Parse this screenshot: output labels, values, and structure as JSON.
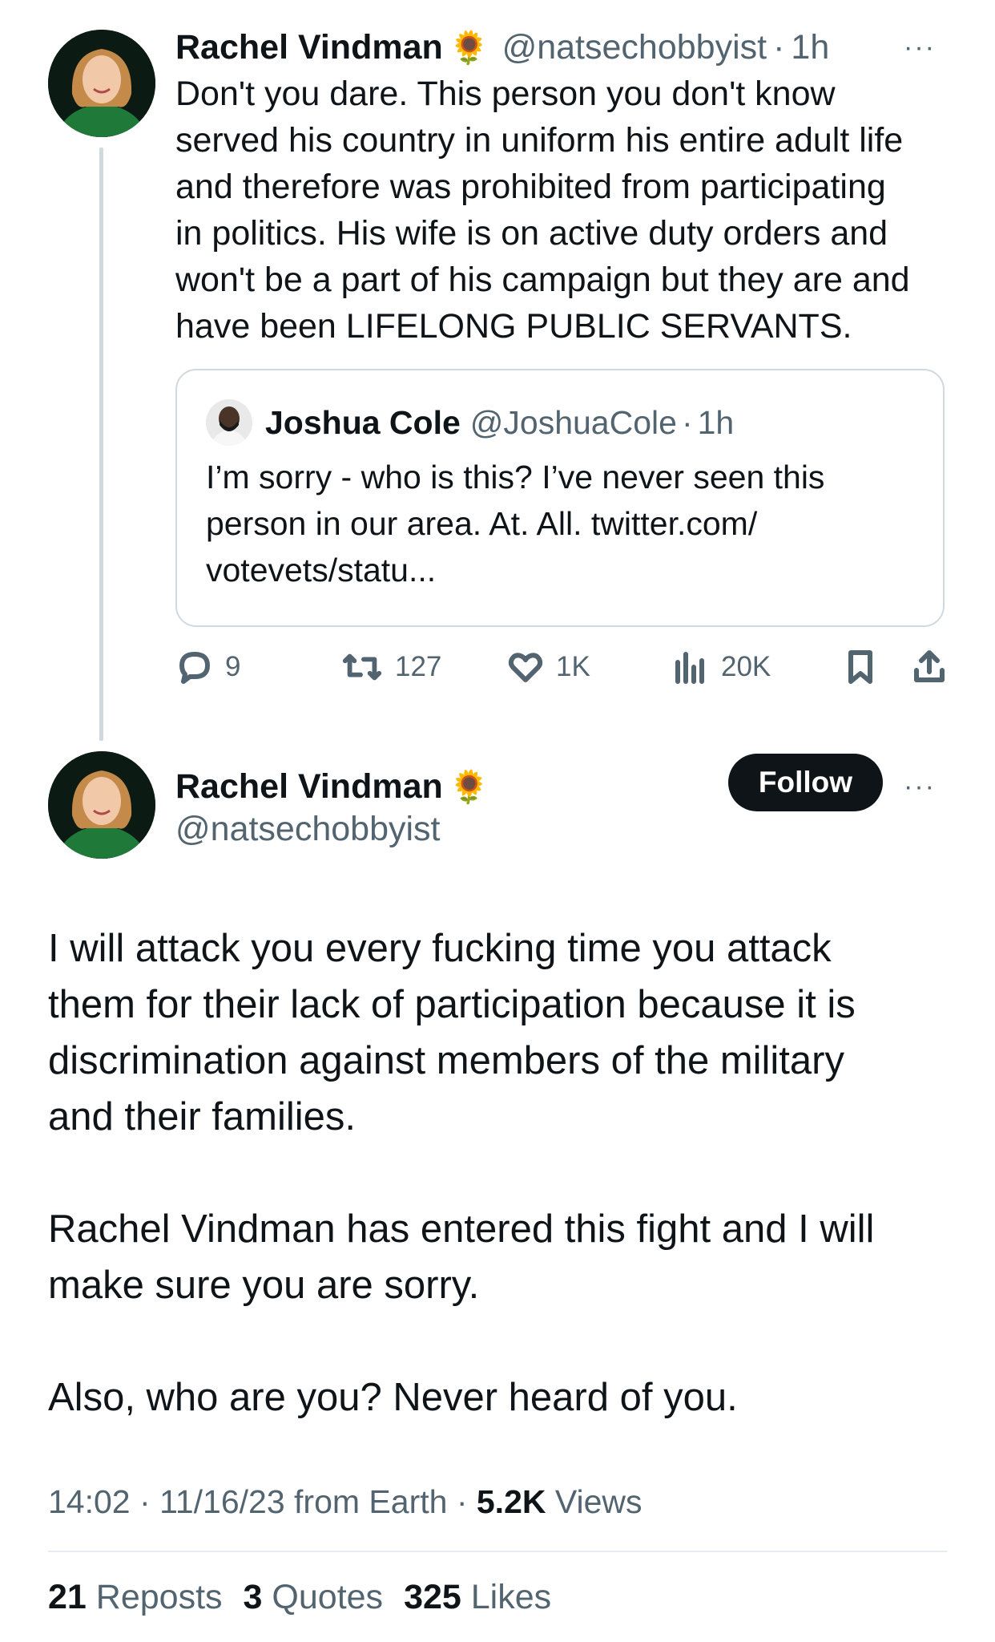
{
  "reply_tweet": {
    "author_name": "Rachel Vindman",
    "author_emoji": "🌻",
    "author_handle": "@natsechobbyist",
    "time": "1h",
    "more": "···",
    "text_lines": [
      "Don't you dare. This person you don't know",
      "served his country in uniform his entire adult life",
      "and therefore was prohibited from participating",
      "in politics. His wife is on active duty orders and",
      "won't be a part of his campaign but they are and",
      "have been LIFELONG PUBLIC SERVANTS."
    ],
    "quoted": {
      "author_name": "Joshua Cole",
      "author_handle": "@JoshuaCole",
      "time": "1h",
      "text_lines": [
        "I’m sorry - who is this? I’ve never seen this",
        "person in our area. At. All. twitter.com/",
        "votevets/statu..."
      ]
    },
    "actions": {
      "replies": "9",
      "reposts": "127",
      "likes": "1K",
      "views": "20K"
    }
  },
  "main_tweet": {
    "author_name": "Rachel Vindman",
    "author_emoji": "🌻",
    "author_handle": "@natsechobbyist",
    "follow_label": "Follow",
    "more": "···",
    "paragraphs": [
      [
        "I will attack you every fucking time you attack",
        "them for their lack of participation because it is",
        "discrimination against members of the military",
        "and their families."
      ],
      [
        "Rachel Vindman has entered this fight and I will",
        "make sure you are sorry."
      ],
      [
        "Also, who are you? Never heard of you."
      ]
    ],
    "meta": {
      "time": "14:02",
      "date": "11/16/23",
      "source": "from Earth",
      "views_count": "5.2K",
      "views_label": "Views"
    },
    "stats": {
      "reposts_count": "21",
      "reposts_label": "Reposts",
      "quotes_count": "3",
      "quotes_label": "Quotes",
      "likes_count": "325",
      "likes_label": "Likes"
    }
  },
  "colors": {
    "text": "#0f1419",
    "muted": "#536471",
    "border": "#cfd9de",
    "follow_bg": "#0f1419"
  }
}
